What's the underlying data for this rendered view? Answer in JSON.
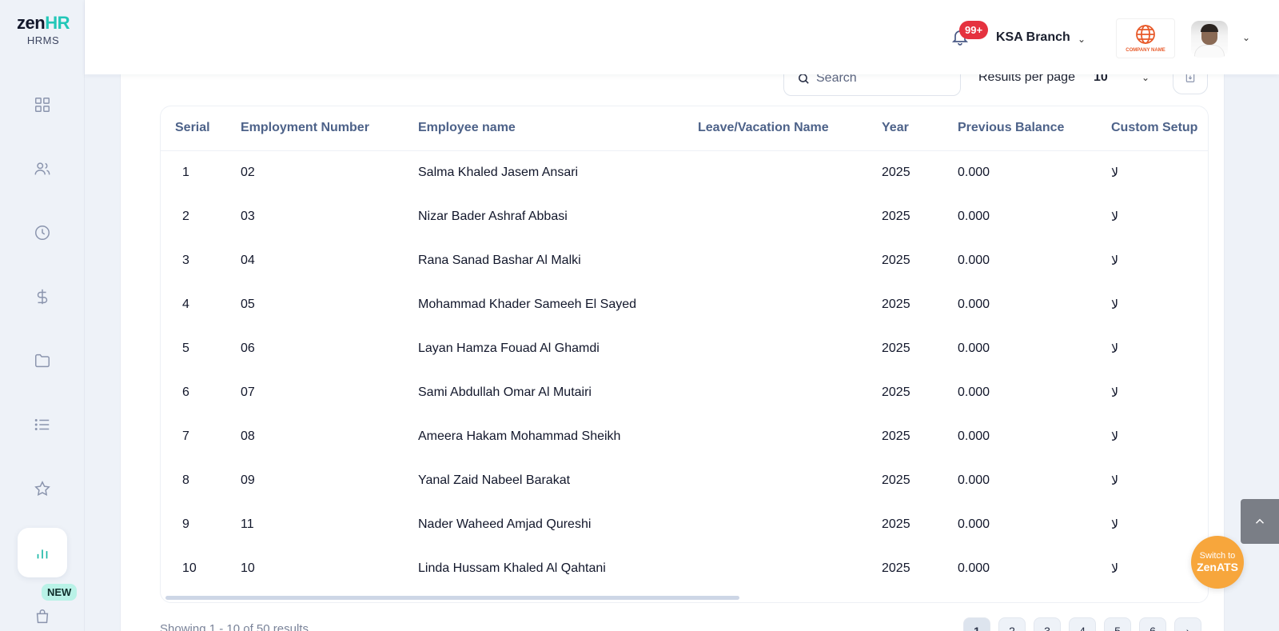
{
  "brand": {
    "logo_main": "zen",
    "logo_accent": "HR",
    "logo_sub": "HRMS"
  },
  "sidebar": {
    "items": [
      {
        "icon": "dashboard-icon"
      },
      {
        "icon": "users-icon"
      },
      {
        "icon": "clock-icon"
      },
      {
        "icon": "dollar-icon"
      },
      {
        "icon": "folder-icon"
      },
      {
        "icon": "list-icon"
      },
      {
        "icon": "star-icon"
      },
      {
        "icon": "bar-chart-icon",
        "active": true
      },
      {
        "icon": "shopping-bag-icon"
      }
    ],
    "new_badge": "NEW"
  },
  "header": {
    "notifications_count": "99+",
    "branch": "KSA Branch",
    "company_logo_text": "COMPANY NAME"
  },
  "toolbar": {
    "search_placeholder": "Search",
    "results_per_page_label": "Results per page",
    "results_per_page_value": "10"
  },
  "table": {
    "columns": [
      "Serial",
      "Employment Number",
      "Employee name",
      "Leave/Vacation Name",
      "Year",
      "Previous Balance",
      "Custom Setup"
    ],
    "rows": [
      {
        "serial": "1",
        "emp_no": "02",
        "name": "Salma Khaled Jasem Ansari",
        "leave": "",
        "year": "2025",
        "prev_balance": "0.000",
        "custom": "لا"
      },
      {
        "serial": "2",
        "emp_no": "03",
        "name": "Nizar Bader Ashraf Abbasi",
        "leave": "",
        "year": "2025",
        "prev_balance": "0.000",
        "custom": "لا"
      },
      {
        "serial": "3",
        "emp_no": "04",
        "name": "Rana Sanad Bashar Al Malki",
        "leave": "",
        "year": "2025",
        "prev_balance": "0.000",
        "custom": "لا"
      },
      {
        "serial": "4",
        "emp_no": "05",
        "name": "Mohammad Khader Sameeh El Sayed",
        "leave": "",
        "year": "2025",
        "prev_balance": "0.000",
        "custom": "لا"
      },
      {
        "serial": "5",
        "emp_no": "06",
        "name": "Layan Hamza Fouad Al Ghamdi",
        "leave": "",
        "year": "2025",
        "prev_balance": "0.000",
        "custom": "لا"
      },
      {
        "serial": "6",
        "emp_no": "07",
        "name": "Sami Abdullah Omar Al Mutairi",
        "leave": "",
        "year": "2025",
        "prev_balance": "0.000",
        "custom": "لا"
      },
      {
        "serial": "7",
        "emp_no": "08",
        "name": "Ameera Hakam Mohammad Sheikh",
        "leave": "",
        "year": "2025",
        "prev_balance": "0.000",
        "custom": "لا"
      },
      {
        "serial": "8",
        "emp_no": "09",
        "name": "Yanal Zaid Nabeel Barakat",
        "leave": "",
        "year": "2025",
        "prev_balance": "0.000",
        "custom": "لا"
      },
      {
        "serial": "9",
        "emp_no": "11",
        "name": "Nader Waheed Amjad Qureshi",
        "leave": "",
        "year": "2025",
        "prev_balance": "0.000",
        "custom": "لا"
      },
      {
        "serial": "10",
        "emp_no": "10",
        "name": "Linda Hussam Khaled Al Qahtani",
        "leave": "",
        "year": "2025",
        "prev_balance": "0.000",
        "custom": "لا"
      }
    ]
  },
  "footer": {
    "showing_text": "Showing 1 - 10 of 50 results",
    "pages": [
      "1",
      "2",
      "3",
      "4",
      "5",
      "6"
    ],
    "current_page": "1"
  },
  "floating": {
    "scroll_top_icon": "chevron-up-icon",
    "switch_line1": "Switch to",
    "switch_line2": "ZenATS"
  },
  "colors": {
    "accent": "#1ab7a6",
    "badge_red": "#e5323f",
    "header_text": "#4d6289",
    "zenats": "#f7a63c"
  }
}
